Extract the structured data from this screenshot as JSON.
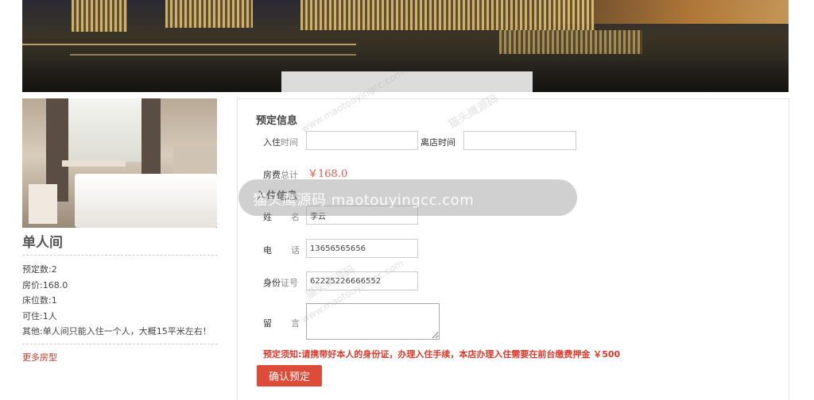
{
  "room": {
    "name": "单人间",
    "details": [
      "预定数:2",
      "房价:168.0",
      "床位数:1",
      "可住:1人",
      "其他:单人间只能入住一个人，大概15平米左右！"
    ],
    "more_link": "更多房型"
  },
  "booking": {
    "section_title": "预定信息",
    "checkin_label_a": "入住",
    "checkin_label_b": "时间",
    "checkin_value": "",
    "checkout_label": "离店时间",
    "checkout_value": "",
    "total_label_a": "房费",
    "total_label_b": "总计",
    "total_price": "￥168.0"
  },
  "guest": {
    "section_title": "入住信息",
    "name_label_a": "姓",
    "name_label_b": "名",
    "name_value": "李云",
    "phone_label_a": "电",
    "phone_label_b": "话",
    "phone_value": "13656565656",
    "id_label_a": "身份",
    "id_label_b": "证号",
    "id_value": "62225226666552",
    "remark_label_a": "留",
    "remark_label_b": "言",
    "remark_value": ""
  },
  "notice": "预定须知:请携带好本人的身份证，办理入住手续，本店办理入住需要在前台缴费押金 ￥500",
  "submit_label": "确认预定",
  "watermark": {
    "main": "猫头鹰源码 maotouyingcc.com",
    "diag_cn": "猫头鹰源码",
    "diag_en": "www.maotouyingcc.com"
  },
  "colors": {
    "accent": "#dd4b39",
    "price": "#e05a4a",
    "notice": "#d93a2b"
  }
}
